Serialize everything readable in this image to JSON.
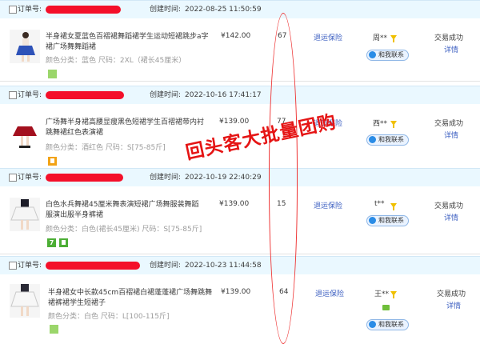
{
  "header_labels": {
    "order_no": "订单号:",
    "created": "创建时间:"
  },
  "orders": [
    {
      "created_at": "2022-08-25 11:50:59",
      "title_line1": "半身裙女夏蓝色百褶裙舞蹈裙学生运动短裙跳步a字",
      "title_line2": "裙广场舞舞蹈裙",
      "spec": "颜色分类：蓝色  尺码：2XL（裙长45厘米）",
      "price": "¥142.00",
      "quantity": "67",
      "service": "退运保险",
      "buyer": "周**",
      "contact": "和我联系",
      "status": "交易成功",
      "detail": "详情"
    },
    {
      "created_at": "2022-10-16 17:41:17",
      "title_line1": "广场舞半身裙高腰显瘦黑色短裙学生百褶裙带内衬",
      "title_line2": "跳舞裙红色表演裙",
      "spec": "颜色分类：酒红色  尺码：S[75-85斤]",
      "price": "¥139.00",
      "quantity": "77",
      "service": "退运保险",
      "buyer": "西**",
      "contact": "和我联系",
      "status": "交易成功",
      "detail": "详情"
    },
    {
      "created_at": "2022-10-19 22:40:29",
      "title_line1": "白色水兵舞裙45厘米舞表演短裙广场舞服装舞蹈",
      "title_line2": "服演出服半身裤裙",
      "spec": "颜色分类：白色(裙长45厘米)  尺码：S[75-85斤]",
      "price": "¥139.00",
      "quantity": "15",
      "service": "退运保险",
      "buyer": "t**",
      "contact": "和我联系",
      "status": "交易成功",
      "detail": "详情"
    },
    {
      "created_at": "2022-10-23 11:44:58",
      "title_line1": "半身裙女中长款45cm百褶裙白裙蓬蓬裙广场舞跳舞",
      "title_line2": "裙裤裙学生短裙子",
      "spec": "颜色分类：白色  尺码：L[100-115斤]",
      "price": "¥139.00",
      "quantity": "64",
      "service": "退运保险",
      "buyer": "王**",
      "contact": "和我联系",
      "status": "交易成功",
      "detail": "详情"
    }
  ],
  "badge_letter": "7",
  "overlay_text": "回头客大批量团购",
  "colors": {
    "header_bg": "#eaf8ff",
    "link": "#3c5fc1",
    "redact": "#f4102a",
    "overlay": "#e51414"
  },
  "icons": [
    "checkbox",
    "redaction-bar",
    "product-thumbnail",
    "filter-icon",
    "contact-icon",
    "green-badge-icon",
    "yellow-badge-icon",
    "chat-icon"
  ]
}
